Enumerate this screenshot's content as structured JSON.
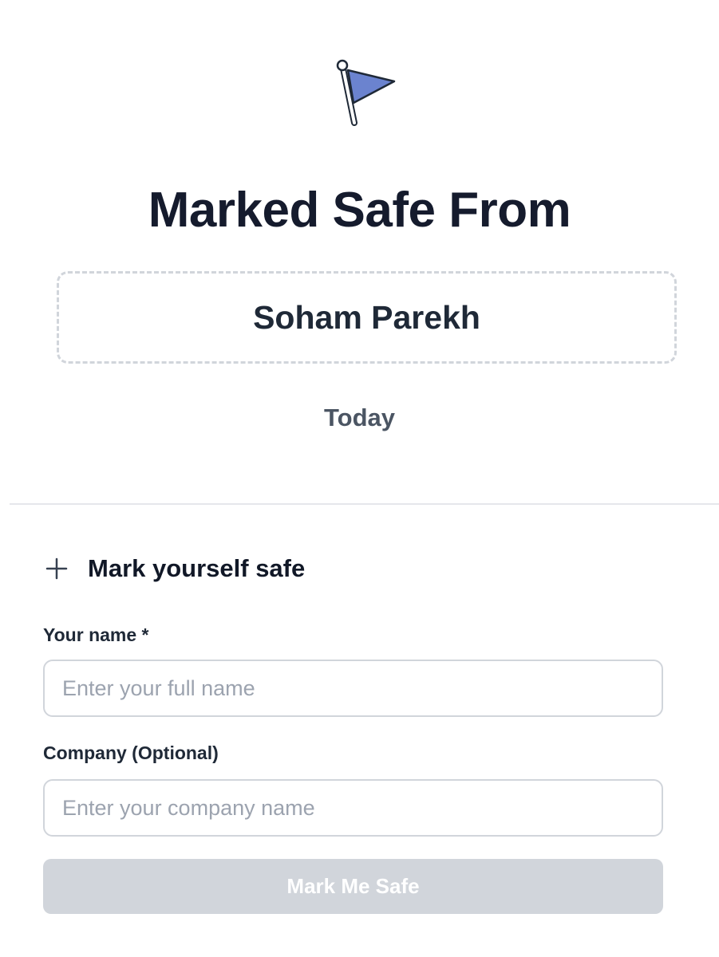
{
  "header": {
    "icon": "flag-icon",
    "title": "Marked Safe From",
    "subject_name": "Soham Parekh",
    "date": "Today"
  },
  "form": {
    "toggle_icon": "plus-icon",
    "heading": "Mark yourself safe",
    "fields": [
      {
        "label": "Your name *",
        "placeholder": "Enter your full name",
        "value": ""
      },
      {
        "label": "Company (Optional)",
        "placeholder": "Enter your company name",
        "value": ""
      }
    ],
    "submit_label": "Mark Me Safe",
    "submit_disabled": true
  },
  "colors": {
    "flag_fill": "#6b83cf",
    "title_text": "#151b2d",
    "muted_text": "#4b5563",
    "border": "#d1d5db",
    "placeholder": "#9ca3af",
    "disabled_button": "#d1d5db"
  }
}
